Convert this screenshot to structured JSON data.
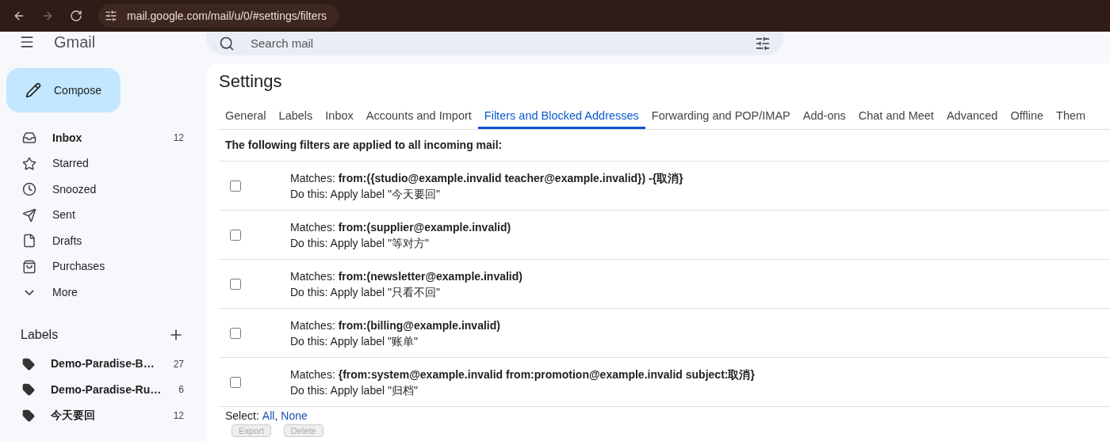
{
  "browser": {
    "url": "mail.google.com/mail/u/0/#settings/filters"
  },
  "header": {
    "logo": "Gmail",
    "search": {
      "placeholder": "Search mail"
    }
  },
  "sidebar": {
    "compose": "Compose",
    "items": [
      {
        "label": "Inbox",
        "count": "12",
        "bold": true
      },
      {
        "label": "Starred",
        "bold": false
      },
      {
        "label": "Snoozed",
        "bold": false
      },
      {
        "label": "Sent",
        "bold": false
      },
      {
        "label": "Drafts",
        "bold": false
      },
      {
        "label": "Purchases",
        "bold": false
      },
      {
        "label": "More",
        "bold": false
      }
    ],
    "labels_title": "Labels",
    "labels": [
      {
        "label": "Demo-Paradise-B…",
        "count": "27"
      },
      {
        "label": "Demo-Paradise-Ru…",
        "count": "6"
      },
      {
        "label": "今天要回",
        "count": "12"
      }
    ]
  },
  "settings": {
    "title": "Settings",
    "tabs": [
      {
        "label": "General",
        "selected": false
      },
      {
        "label": "Labels",
        "selected": false
      },
      {
        "label": "Inbox",
        "selected": false
      },
      {
        "label": "Accounts and Import",
        "selected": false
      },
      {
        "label": "Filters and Blocked Addresses",
        "selected": true
      },
      {
        "label": "Forwarding and POP/IMAP",
        "selected": false
      },
      {
        "label": "Add-ons",
        "selected": false
      },
      {
        "label": "Chat and Meet",
        "selected": false
      },
      {
        "label": "Advanced",
        "selected": false
      },
      {
        "label": "Offline",
        "selected": false
      },
      {
        "label": "Them",
        "selected": false
      }
    ],
    "heading": "The following filters are applied to all incoming mail:",
    "filters": [
      {
        "matches": "Matches: **from:({studio@example.invalid teacher@example.invalid}) -{取消}**",
        "action": "Do this: Apply label \"今天要回\"",
        "checked": false
      },
      {
        "matches": "Matches: **from:(supplier@example.invalid)**",
        "action": "Do this: Apply label \"等对方\"",
        "checked": false
      },
      {
        "matches": "Matches: **from:(newsletter@example.invalid)**",
        "action": "Do this: Apply label \"只看不回\"",
        "checked": false
      },
      {
        "matches": "Matches: **from:(billing@example.invalid)**",
        "action": "Do this: Apply label \"账单\"",
        "checked": false
      },
      {
        "matches": "Matches: **{from:system@example.invalid from:promotion@example.invalid subject:取消}**",
        "action": "Do this: Apply label \"归档\"",
        "checked": false
      }
    ],
    "select": {
      "label": "Select:",
      "all": "All",
      "separator": ",",
      "none": "None"
    },
    "buttons": [
      {
        "label": "Export",
        "disabled": true
      },
      {
        "label": "Delete",
        "disabled": true
      }
    ]
  }
}
